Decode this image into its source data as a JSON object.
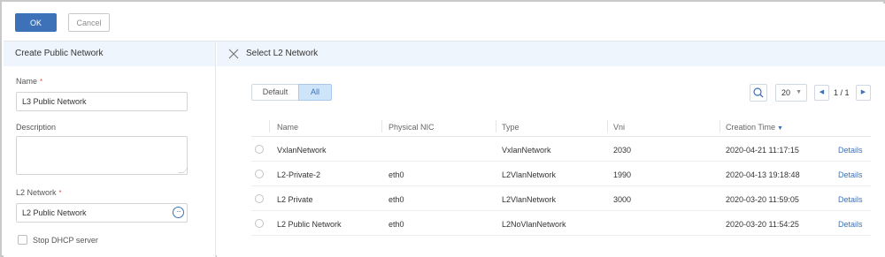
{
  "toolbar": {
    "ok_label": "OK",
    "cancel_label": "Cancel"
  },
  "left_panel": {
    "title": "Create Public Network",
    "name_label": "Name",
    "name_value": "L3 Public Network",
    "description_label": "Description",
    "description_value": "",
    "l2_label": "L2 Network",
    "l2_value": "L2 Public Network",
    "required_mark": "*",
    "more_icon": "ellipsis-circle-icon",
    "stop_dhcp_label": "Stop DHCP server",
    "stop_dhcp_checked": false
  },
  "right_panel": {
    "title": "Select L2 Network",
    "close_icon": "close-icon",
    "filter_tabs": [
      {
        "label": "Default",
        "active": false
      },
      {
        "label": "All",
        "active": true
      }
    ],
    "page_size": "20",
    "page_indicator": "1 / 1",
    "columns": {
      "name": "Name",
      "physical_nic": "Physical NIC",
      "type": "Type",
      "vni": "Vni",
      "creation_time": "Creation Time"
    },
    "sorted_column": "creation_time",
    "rows": [
      {
        "name": "VxlanNetwork",
        "physical_nic": "",
        "type": "VxlanNetwork",
        "vni": "2030",
        "creation_time": "2020-04-21 11:17:15",
        "action": "Details",
        "selected": false
      },
      {
        "name": "L2-Private-2",
        "physical_nic": "eth0",
        "type": "L2VlanNetwork",
        "vni": "1990",
        "creation_time": "2020-04-13 19:18:48",
        "action": "Details",
        "selected": false
      },
      {
        "name": "L2 Private",
        "physical_nic": "eth0",
        "type": "L2VlanNetwork",
        "vni": "3000",
        "creation_time": "2020-03-20 11:59:05",
        "action": "Details",
        "selected": false
      },
      {
        "name": "L2 Public Network",
        "physical_nic": "eth0",
        "type": "L2NoVlanNetwork",
        "vni": "",
        "creation_time": "2020-03-20 11:54:25",
        "action": "Details",
        "selected": false
      }
    ]
  },
  "colors": {
    "primary": "#3d72b8",
    "header_bg": "#eef5fc",
    "required": "#e0584e",
    "active_tab_bg": "#cde4f9"
  }
}
